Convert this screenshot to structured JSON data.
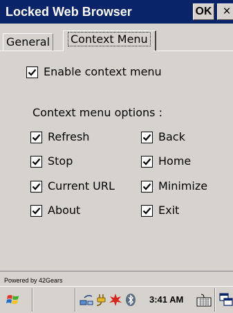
{
  "window": {
    "title": "Locked Web Browser",
    "ok_label": "OK",
    "close_label": "×"
  },
  "tabs": [
    {
      "label": "General",
      "selected": false
    },
    {
      "label": "Context Menu",
      "selected": true
    }
  ],
  "enable_context_menu": {
    "label": "Enable context menu",
    "checked": true
  },
  "options_heading": "Context menu options :",
  "options": [
    {
      "label": "Refresh",
      "checked": true
    },
    {
      "label": "Back",
      "checked": true
    },
    {
      "label": "Stop",
      "checked": true
    },
    {
      "label": "Home",
      "checked": true
    },
    {
      "label": "Current URL",
      "checked": true
    },
    {
      "label": "Minimize",
      "checked": true
    },
    {
      "label": "About",
      "checked": true
    },
    {
      "label": "Exit",
      "checked": true
    }
  ],
  "footer": {
    "powered_by": "Powered by 42Gears"
  },
  "taskbar": {
    "clock": "3:41 AM",
    "icons": [
      "windows-start-icon",
      "network-icon",
      "power-plug-icon",
      "alert-icon",
      "bluetooth-icon",
      "keyboard-icon",
      "window-switch-icon"
    ]
  },
  "colors": {
    "title_bar": "#0a246a",
    "surface": "#d6d3ce"
  }
}
